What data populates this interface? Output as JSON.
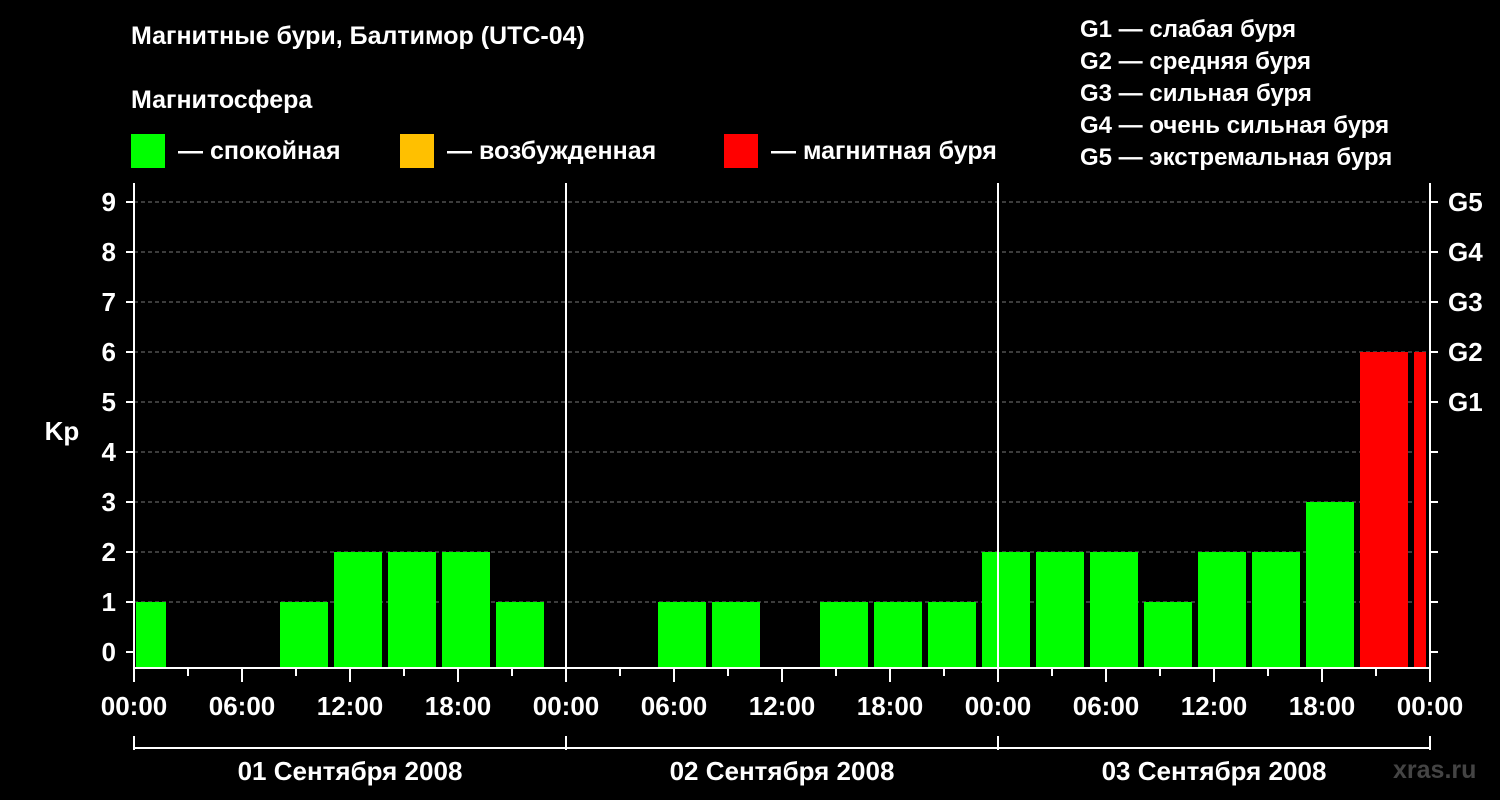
{
  "title": "Магнитные бури, Балтимор (UTC-04)",
  "magnetosphere_label": "Магнитосфера",
  "legend": [
    {
      "label": "— спокойная",
      "color": "#00ff00"
    },
    {
      "label": "— возбужденная",
      "color": "#ffc000"
    },
    {
      "label": "— магнитная буря",
      "color": "#ff0000"
    }
  ],
  "storm_scale": [
    "G1 — слабая буря",
    "G2 — средняя буря",
    "G3 — сильная буря",
    "G4 — очень сильная буря",
    "G5 — экстремальная буря"
  ],
  "watermark": "xras.ru",
  "chart_data": {
    "type": "bar",
    "ylabel": "Kp",
    "ylim": [
      0,
      9
    ],
    "yticks": [
      "0",
      "1",
      "2",
      "3",
      "4",
      "5",
      "6",
      "7",
      "8",
      "9"
    ],
    "right_ticks": [
      {
        "kp": 5,
        "label": "G1"
      },
      {
        "kp": 6,
        "label": "G2"
      },
      {
        "kp": 7,
        "label": "G3"
      },
      {
        "kp": 8,
        "label": "G4"
      },
      {
        "kp": 9,
        "label": "G5"
      }
    ],
    "grid": "dashed horizontal",
    "xticks": [
      "00:00",
      "06:00",
      "12:00",
      "18:00",
      "00:00",
      "06:00",
      "12:00",
      "18:00",
      "00:00",
      "06:00",
      "12:00",
      "18:00",
      "00:00"
    ],
    "days": [
      "01 Сентября 2008",
      "02 Сентября 2008",
      "03 Сентября 2008"
    ],
    "bars": [
      {
        "start": 0,
        "end": 2,
        "kp": 1
      },
      {
        "start": 8,
        "end": 11,
        "kp": 1
      },
      {
        "start": 11,
        "end": 14,
        "kp": 2
      },
      {
        "start": 14,
        "end": 17,
        "kp": 2
      },
      {
        "start": 17,
        "end": 20,
        "kp": 2
      },
      {
        "start": 20,
        "end": 23,
        "kp": 1
      },
      {
        "start": 29,
        "end": 32,
        "kp": 1
      },
      {
        "start": 32,
        "end": 35,
        "kp": 1
      },
      {
        "start": 38,
        "end": 41,
        "kp": 1
      },
      {
        "start": 41,
        "end": 44,
        "kp": 1
      },
      {
        "start": 44,
        "end": 47,
        "kp": 1
      },
      {
        "start": 47,
        "end": 50,
        "kp": 2
      },
      {
        "start": 50,
        "end": 53,
        "kp": 2
      },
      {
        "start": 53,
        "end": 56,
        "kp": 2
      },
      {
        "start": 56,
        "end": 59,
        "kp": 1
      },
      {
        "start": 59,
        "end": 62,
        "kp": 2
      },
      {
        "start": 62,
        "end": 65,
        "kp": 2
      },
      {
        "start": 65,
        "end": 68,
        "kp": 3
      },
      {
        "start": 68,
        "end": 71,
        "kp": 6
      },
      {
        "start": 71,
        "end": 72,
        "kp": 6
      }
    ],
    "thresholds": {
      "storm": 5,
      "active": 4
    }
  }
}
